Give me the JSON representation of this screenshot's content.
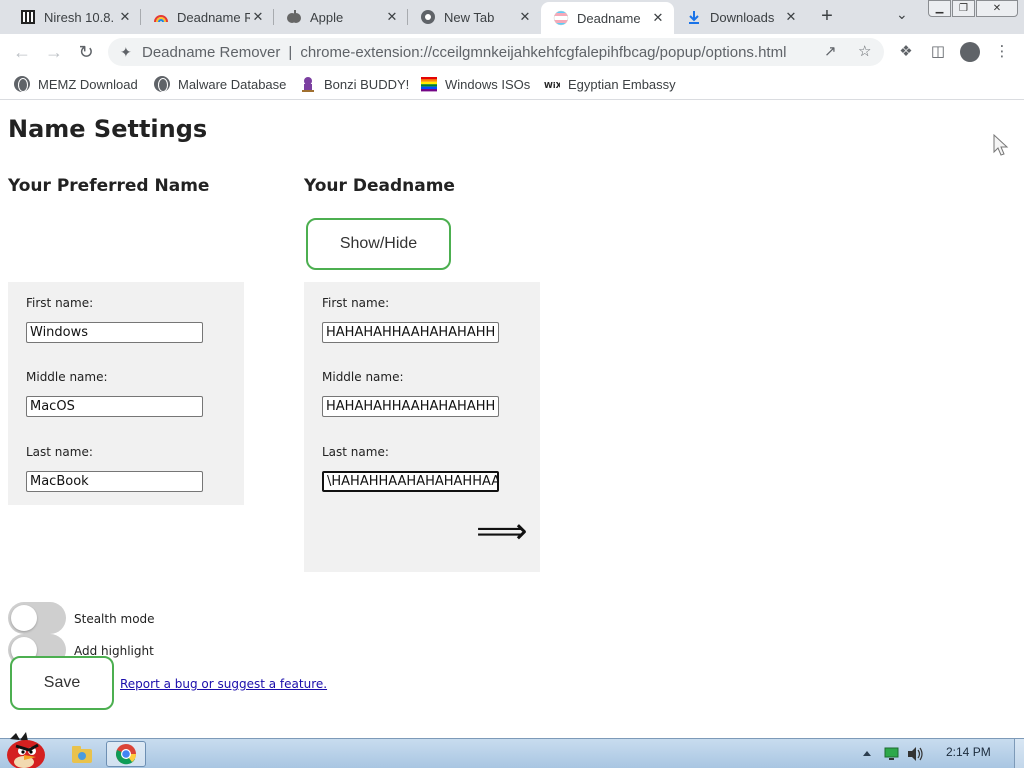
{
  "tabs": [
    {
      "title": "Niresh 10.8.",
      "icon": "book-icon"
    },
    {
      "title": "Deadname R",
      "icon": "rainbow-icon"
    },
    {
      "title": "Apple",
      "icon": "apple-icon"
    },
    {
      "title": "New Tab",
      "icon": "chrome-icon"
    },
    {
      "title": "Deadname",
      "icon": "trans-flag-icon",
      "active": true
    },
    {
      "title": "Downloads",
      "icon": "download-icon"
    }
  ],
  "close_glyph": "✕",
  "new_tab_glyph": "+",
  "window_controls": {
    "minimize": "▁",
    "restore": "❐",
    "close": "✕"
  },
  "omnibox": {
    "site_name": "Deadname Remover",
    "divider": "|",
    "url": "chrome-extension://cceilgmnkeijahkehfcgfalepihfbcag/popup/options.html"
  },
  "bookmarks": [
    {
      "label": "MEMZ Download",
      "icon": "globe-icon"
    },
    {
      "label": "Malware Database",
      "icon": "globe-icon"
    },
    {
      "label": "Bonzi BUDDY!",
      "icon": "bonzi-icon"
    },
    {
      "label": "Windows ISOs",
      "icon": "rainbow-flag-icon"
    },
    {
      "label": "Egyptian Embassy",
      "icon": "wix-icon"
    }
  ],
  "page": {
    "heading": "Name Settings",
    "preferred_heading": "Your Preferred Name",
    "deadname_heading": "Your Deadname",
    "show_hide_label": "Show/Hide",
    "arrow_glyph": "⟹",
    "preferred": {
      "first_label": "First name:",
      "first_value": "Windows",
      "middle_label": "Middle name:",
      "middle_value": "MacOS",
      "last_label": "Last name:",
      "last_value": "MacBook"
    },
    "deadname": {
      "first_label": "First name:",
      "first_value": "HAHAHAHHAAHAHAHAHH",
      "middle_label": "Middle name:",
      "middle_value": "HAHAHAHHAAHAHAHAHH",
      "last_label": "Last name:",
      "last_value": "\\HAHAHHAAHAHAHAHHAA"
    },
    "stealth_label": "Stealth mode",
    "highlight_label": "Add highlight",
    "stealth_on": false,
    "highlight_on": false,
    "save_label": "Save",
    "report_link": "Report a bug or suggest a feature."
  },
  "taskbar": {
    "clock": "2:14 PM"
  },
  "colors": {
    "accent_green": "#4caf50",
    "panel_bg": "#f1f1f1",
    "link": "#1a0dab"
  }
}
